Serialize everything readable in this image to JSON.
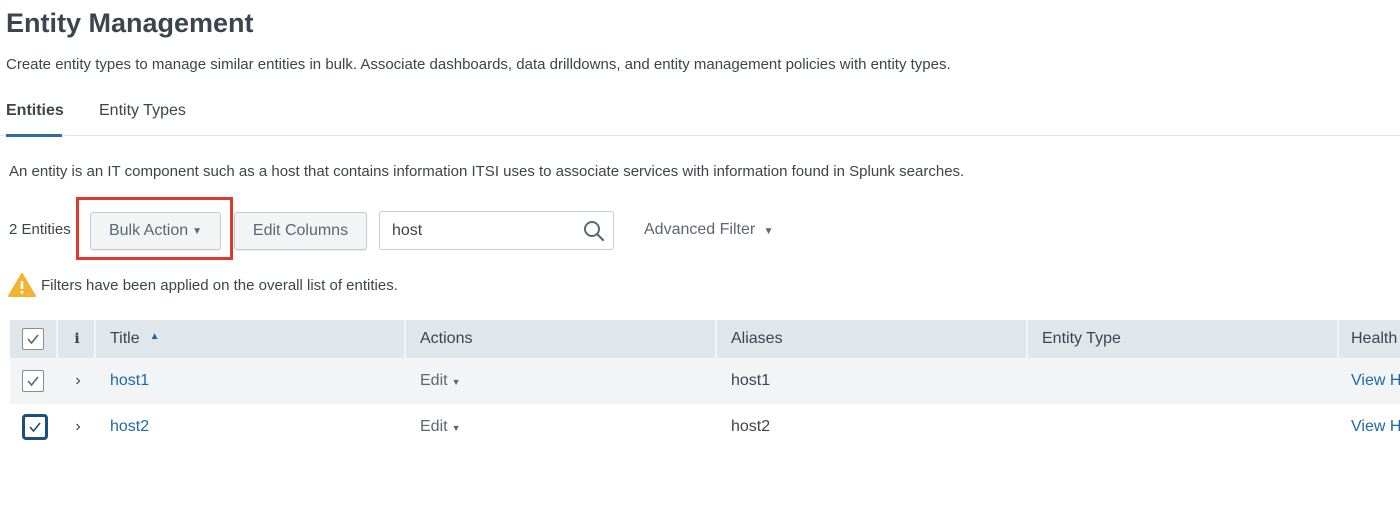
{
  "header": {
    "title": "Entity Management",
    "description": "Create entity types to manage similar entities in bulk. Associate dashboards, data drilldowns, and entity management policies with entity types."
  },
  "tabs": [
    {
      "label": "Entities",
      "active": true
    },
    {
      "label": "Entity Types",
      "active": false
    }
  ],
  "intro": "An entity is an IT component such as a host that contains information ITSI uses to associate services with information found in Splunk searches.",
  "toolbar": {
    "count_label": "2 Entities",
    "bulk_action_label": "Bulk Action",
    "edit_columns_label": "Edit Columns",
    "search_value": "host",
    "search_icon": "search-icon",
    "advanced_filter_label": "Advanced Filter"
  },
  "warning": {
    "icon": "warning-icon",
    "text": "Filters have been applied on the overall list of entities."
  },
  "table": {
    "columns": {
      "info": "i",
      "title": "Title",
      "actions": "Actions",
      "aliases": "Aliases",
      "entity_type": "Entity Type",
      "health": "Health"
    },
    "sort": {
      "column": "Title",
      "direction": "ascending"
    },
    "rows": [
      {
        "checked": true,
        "title": "host1",
        "action": "Edit",
        "aliases": "host1",
        "entity_type": "",
        "health": "View H"
      },
      {
        "checked": true,
        "title": "host2",
        "action": "Edit",
        "aliases": "host2",
        "entity_type": "",
        "health": "View H"
      }
    ]
  },
  "colors": {
    "accent": "#2d6ca2",
    "link": "#1e6aa8",
    "highlight": "#dc3b2c",
    "warning": "#f2b430"
  }
}
